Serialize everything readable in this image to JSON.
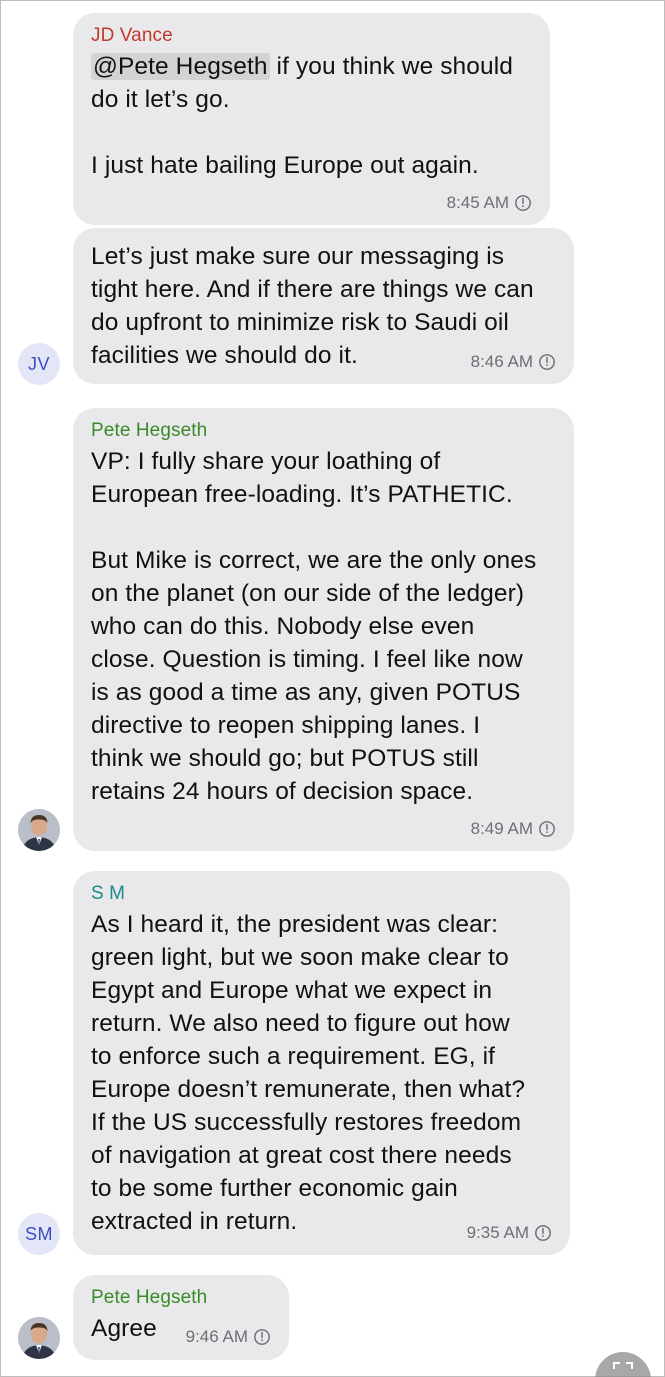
{
  "messages": [
    {
      "sender": "JD Vance",
      "mention": "@Pete Hegseth",
      "text_after_mention": " if you think we should\ndo it let’s go.\n\nI just hate bailing Europe out again.",
      "time": "8:45 AM"
    },
    {
      "text": "Let’s just make sure our messaging is\ntight here. And if there are things we can\ndo upfront to minimize risk to Saudi oil\nfacilities we should do it.",
      "time": "8:46 AM",
      "avatar_initials": "JV"
    },
    {
      "sender": "Pete Hegseth",
      "text": "VP: I fully share your loathing of\nEuropean free-loading. It’s PATHETIC.\n\nBut Mike is correct, we are the only ones\non the planet (on our side of the ledger)\nwho can do this. Nobody else even\nclose. Question is timing. I feel like now\nis as good a time as any, given POTUS\ndirective to reopen shipping lanes. I\nthink we should go; but POTUS still\nretains 24 hours of decision space.",
      "time": "8:49 AM"
    },
    {
      "sender": "S M",
      "text": "As I heard it, the president was clear:\ngreen light, but we soon make clear to\nEgypt and Europe what we expect in\nreturn. We also need to figure out how\nto enforce such a requirement. EG, if\nEurope doesn’t remunerate, then what?\nIf the US successfully restores freedom\nof navigation at great cost there needs\nto be some further economic gain\nextracted in return.",
      "time": "9:35 AM",
      "avatar_initials": "SM"
    },
    {
      "sender": "Pete Hegseth",
      "text": "Agree",
      "time": "9:46 AM"
    }
  ],
  "icons": {
    "timestamp": "clock-icon",
    "avatar_photo": "person-photo-icon",
    "fab": "expand-icon"
  },
  "colors": {
    "bubble": "#e9e9eb",
    "jd_name": "#c0392b",
    "pete_name": "#3b8a2a",
    "sm_name": "#1b8a8a",
    "initials_avatar_bg": "#e3e6f7",
    "initials_avatar_text": "#3d4fc2"
  }
}
